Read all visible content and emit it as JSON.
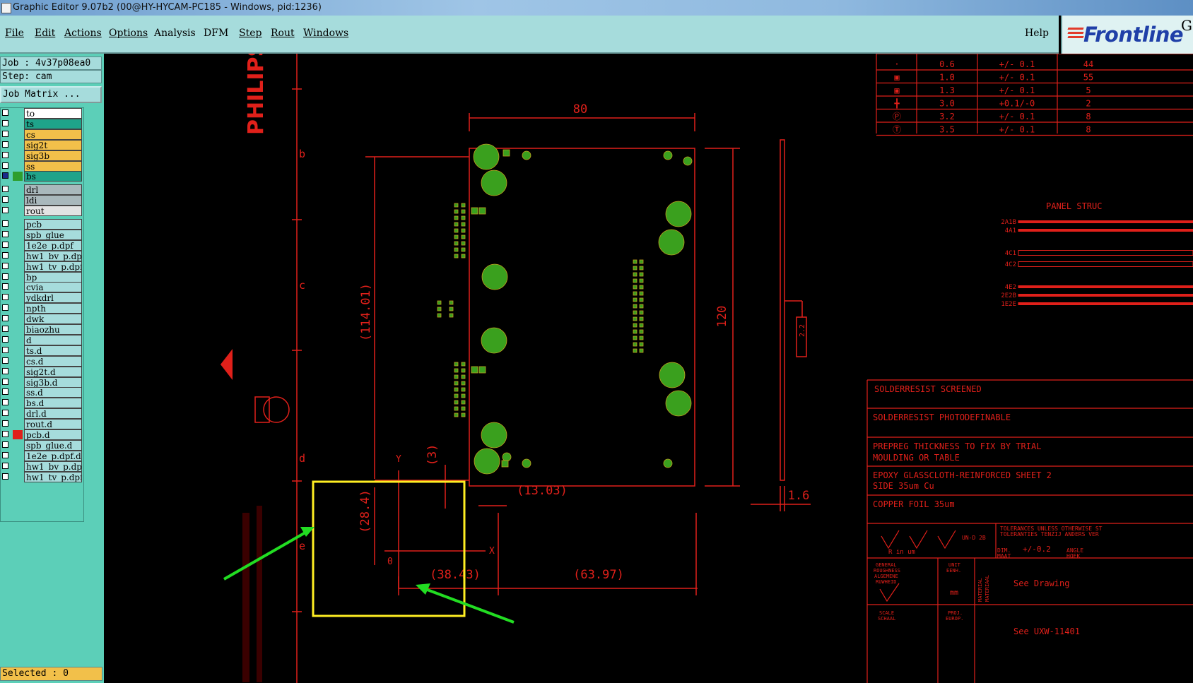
{
  "window": {
    "title": "Graphic Editor 9.07b2 (00@HY-HYCAM-PC185 - Windows, pid:1236)"
  },
  "menu": {
    "items": [
      "File",
      "Edit",
      "Actions",
      "Options",
      "Analysis",
      "DFM",
      "Step",
      "Rout",
      "Windows"
    ],
    "help": "Help"
  },
  "brand": {
    "name": "Frontline",
    "corner_letter": "G"
  },
  "job": {
    "job_label": "Job : 4v37p08ea0",
    "step_label": "Step: cam",
    "matrix_button": "Job Matrix ..."
  },
  "layers": [
    {
      "name": "to",
      "color": "#ffffff",
      "indicator": ""
    },
    {
      "name": "ts",
      "color": "#1fa38a",
      "indicator": ""
    },
    {
      "name": "cs",
      "color": "#f2c04a",
      "indicator": ""
    },
    {
      "name": "sig2t",
      "color": "#f2c04a",
      "indicator": ""
    },
    {
      "name": "sig3b",
      "color": "#f2c04a",
      "indicator": ""
    },
    {
      "name": "ss",
      "color": "#f2c04a",
      "indicator": ""
    },
    {
      "name": "bs",
      "color": "#1fa38a",
      "indicator": "#2e9e2e",
      "active": true
    },
    {
      "name": "drl",
      "color": "#a9b8bc",
      "indicator": ""
    },
    {
      "name": "ldi",
      "color": "#a9b8bc",
      "indicator": ""
    },
    {
      "name": "rout",
      "color": "#e3e3e3",
      "indicator": ""
    },
    {
      "name": "pcb",
      "color": "#a6dcdc",
      "indicator": ""
    },
    {
      "name": "spb_glue",
      "color": "#a6dcdc",
      "indicator": ""
    },
    {
      "name": "1e2e_p.dpf",
      "color": "#a6dcdc",
      "indicator": ""
    },
    {
      "name": "hw1_bv_p.dpf",
      "color": "#a6dcdc",
      "indicator": ""
    },
    {
      "name": "hw1_tv_p.dpf",
      "color": "#a6dcdc",
      "indicator": ""
    },
    {
      "name": "bp",
      "color": "#a6dcdc",
      "indicator": ""
    },
    {
      "name": "cvia",
      "color": "#a6dcdc",
      "indicator": ""
    },
    {
      "name": "ydkdrl",
      "color": "#a6dcdc",
      "indicator": ""
    },
    {
      "name": "npth",
      "color": "#a6dcdc",
      "indicator": ""
    },
    {
      "name": "dwk",
      "color": "#a6dcdc",
      "indicator": ""
    },
    {
      "name": "biaozhu",
      "color": "#a6dcdc",
      "indicator": ""
    },
    {
      "name": "d",
      "color": "#a6dcdc",
      "indicator": ""
    },
    {
      "name": "ts.d",
      "color": "#a6dcdc",
      "indicator": ""
    },
    {
      "name": "cs.d",
      "color": "#a6dcdc",
      "indicator": ""
    },
    {
      "name": "sig2t.d",
      "color": "#a6dcdc",
      "indicator": ""
    },
    {
      "name": "sig3b.d",
      "color": "#a6dcdc",
      "indicator": ""
    },
    {
      "name": "ss.d",
      "color": "#a6dcdc",
      "indicator": ""
    },
    {
      "name": "bs.d",
      "color": "#a6dcdc",
      "indicator": ""
    },
    {
      "name": "drl.d",
      "color": "#a6dcdc",
      "indicator": ""
    },
    {
      "name": "rout.d",
      "color": "#a6dcdc",
      "indicator": ""
    },
    {
      "name": "pcb.d",
      "color": "#a6dcdc",
      "indicator": "#e0201a"
    },
    {
      "name": "spb_glue.d",
      "color": "#a6dcdc",
      "indicator": ""
    },
    {
      "name": "1e2e_p.dpf.d",
      "color": "#a6dcdc",
      "indicator": ""
    },
    {
      "name": "hw1_bv_p.dpf",
      "color": "#a6dcdc",
      "indicator": ""
    },
    {
      "name": "hw1_tv_p.dpf",
      "color": "#a6dcdc",
      "indicator": ""
    }
  ],
  "status": {
    "selected": "Selected : 0"
  },
  "drawing": {
    "dimensions": {
      "width": "80",
      "height": "120",
      "left_dim": "(114.01)",
      "offset_x": "(13.03)",
      "small_y": "(3)",
      "datum_y": "(28.4)",
      "datum_x": "(38.43)",
      "right_x": "(63.97)",
      "thickness": "1.6",
      "detail": "2.2"
    },
    "axis": {
      "x": "X",
      "y": "Y",
      "origin": "0"
    },
    "ruler_letters": [
      "b",
      "c",
      "d",
      "e"
    ],
    "brand_text": "PHILIPS",
    "hole_table": [
      {
        "dia": "0.6",
        "tol": "+/- 0.1",
        "count": "44"
      },
      {
        "dia": "1.0",
        "tol": "+/- 0.1",
        "count": "55"
      },
      {
        "dia": "1.3",
        "tol": "+/- 0.1",
        "count": "5"
      },
      {
        "dia": "3.0",
        "tol": "+0.1/-0",
        "count": "2"
      },
      {
        "dia": "3.2",
        "tol": "+/- 0.1",
        "count": "8"
      },
      {
        "dia": "3.5",
        "tol": "+/- 0.1",
        "count": "8"
      }
    ],
    "panel_title": "PANEL STRUC",
    "panel_layers": [
      "2A1B",
      "4A1",
      "4C1",
      "4C2",
      "4E2",
      "2E2B",
      "1E2E"
    ],
    "notes": [
      "SOLDERRESIST SCREENED",
      "SOLDERRESIST PHOTODEFINABLE",
      "PREPREG THICKNESS TO FIX BY TRIAL",
      "MOULDING OR TABLE",
      "EPOXY GLASSCLOTH-REINFORCED SHEET 2",
      "SIDE 35um Cu",
      "COPPER FOIL 35um"
    ],
    "title_block": {
      "tolerances": "TOLERANCES UNLESS OTHERWISE ST",
      "tolerantie": "TOLERANTIES TENZIJ ANDERS VER",
      "roughness_unit": "R  in um",
      "un_d": "UN-D 2B",
      "dim": "DIM.",
      "maat": "MAAT",
      "tol_value": "+/-0.2",
      "angle": "ANGLE",
      "hoek": "HOEK",
      "general": "GENERAL",
      "roughness": "ROUGHNESS",
      "algemene": "ALGEMENE",
      "ruwheid": "RUWHEID",
      "unit": "UNIT",
      "eenh": "EENH.",
      "mm": "mm",
      "material": "MATERIAL",
      "materiaal": "MATERIAAL",
      "see_drawing": "See Drawing",
      "scale": "SCALE",
      "schaal": "SCHAAL",
      "proj": "PROJ.",
      "europ": "EUROP.",
      "see_ref": "See UXW-11401"
    }
  },
  "colors": {
    "drawing_red": "#e0201a",
    "pad_green": "#3aa01e",
    "highlight_yellow": "#ffee22",
    "arrow_green": "#22dd22"
  }
}
